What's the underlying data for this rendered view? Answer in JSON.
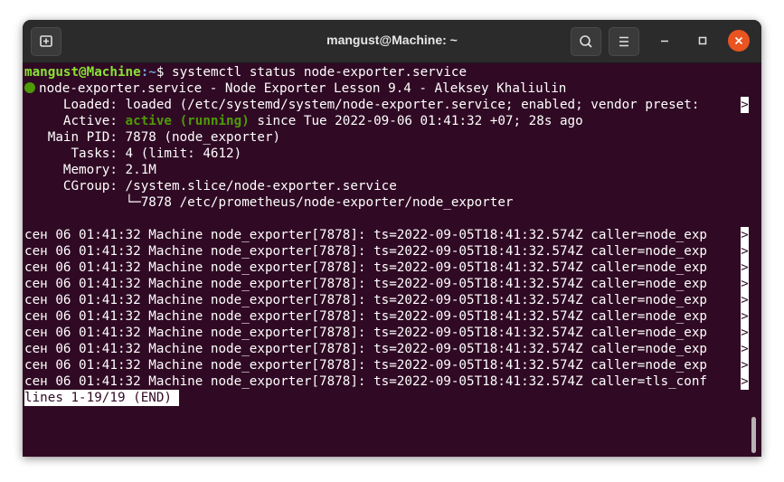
{
  "window": {
    "title": "mangust@Machine: ~",
    "icons": {
      "new_tab": "new-tab-icon",
      "search": "search-icon",
      "menu": "hamburger-menu-icon",
      "minimize": "minimize-icon",
      "maximize": "maximize-icon",
      "close": "close-icon"
    },
    "colors": {
      "background": "#300a24",
      "titlebar": "#2b2b2b",
      "close": "#e95420",
      "prompt_user": "#8ae234",
      "prompt_path": "#729fcf",
      "active": "#4e9a06"
    }
  },
  "terminal": {
    "prompt_user": "mangust@Machine",
    "prompt_path": ":~",
    "prompt_symbol": "$",
    "command": " systemctl status node-exporter.service",
    "status_line": "node-exporter.service - Node Exporter Lesson 9.4 - Aleksey Khaliulin",
    "loaded_line": "     Loaded: loaded (/etc/systemd/system/node-exporter.service; enabled; vendor preset: ",
    "active_prefix": "     Active: ",
    "active_state": "active (running)",
    "active_suffix": " since Tue 2022-09-06 01:41:32 +07; 28s ago",
    "main_pid_line": "   Main PID: 7878 (node_exporter)",
    "tasks_line": "      Tasks: 4 (limit: 4612)",
    "memory_line": "     Memory: 2.1M",
    "cgroup_line": "     CGroup: /system.slice/node-exporter.service",
    "cgroup_child_line": "             └─7878 /etc/prometheus/node-exporter/node_exporter",
    "truncation_marker": ">",
    "log_lines": [
      "сен 06 01:41:32 Machine node_exporter[7878]: ts=2022-09-05T18:41:32.574Z caller=node_exp",
      "сен 06 01:41:32 Machine node_exporter[7878]: ts=2022-09-05T18:41:32.574Z caller=node_exp",
      "сен 06 01:41:32 Machine node_exporter[7878]: ts=2022-09-05T18:41:32.574Z caller=node_exp",
      "сен 06 01:41:32 Machine node_exporter[7878]: ts=2022-09-05T18:41:32.574Z caller=node_exp",
      "сен 06 01:41:32 Machine node_exporter[7878]: ts=2022-09-05T18:41:32.574Z caller=node_exp",
      "сен 06 01:41:32 Machine node_exporter[7878]: ts=2022-09-05T18:41:32.574Z caller=node_exp",
      "сен 06 01:41:32 Machine node_exporter[7878]: ts=2022-09-05T18:41:32.574Z caller=node_exp",
      "сен 06 01:41:32 Machine node_exporter[7878]: ts=2022-09-05T18:41:32.574Z caller=node_exp",
      "сен 06 01:41:32 Machine node_exporter[7878]: ts=2022-09-05T18:41:32.574Z caller=node_exp",
      "сен 06 01:41:32 Machine node_exporter[7878]: ts=2022-09-05T18:41:32.574Z caller=tls_conf"
    ],
    "pager_status": "lines 1-19/19 (END)"
  }
}
